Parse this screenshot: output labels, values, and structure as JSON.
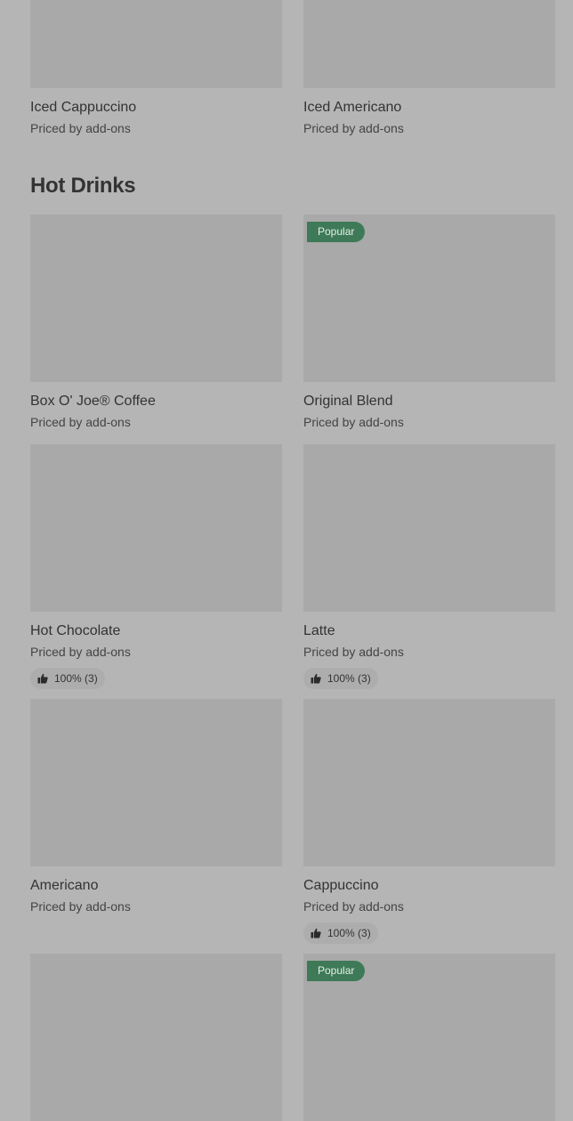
{
  "section": {
    "title": "Hot Drinks"
  },
  "top_items": [
    {
      "name": "Iced Cappuccino",
      "price": "Priced by add-ons"
    },
    {
      "name": "Iced Americano",
      "price": "Priced by add-ons"
    }
  ],
  "items": [
    {
      "name": "Box O' Joe® Coffee",
      "price": "Priced by add-ons"
    },
    {
      "name": "Original Blend",
      "price": "Priced by add-ons",
      "badge": "Popular"
    },
    {
      "name": "Hot Chocolate",
      "price": "Priced by add-ons",
      "rating": "100% (3)"
    },
    {
      "name": "Latte",
      "price": "Priced by add-ons",
      "rating": "100% (3)"
    },
    {
      "name": "Americano",
      "price": "Priced by add-ons"
    },
    {
      "name": "Cappuccino",
      "price": "Priced by add-ons",
      "rating": "100% (3)"
    },
    {
      "badge": ""
    },
    {
      "badge": "Popular"
    }
  ],
  "icons": {
    "thumb": "thumbs-up-icon"
  },
  "colors": {
    "background": "#b5b5b5",
    "image_placeholder": "#a9a9a9",
    "badge": "#3e7a57",
    "text": "#333333"
  }
}
